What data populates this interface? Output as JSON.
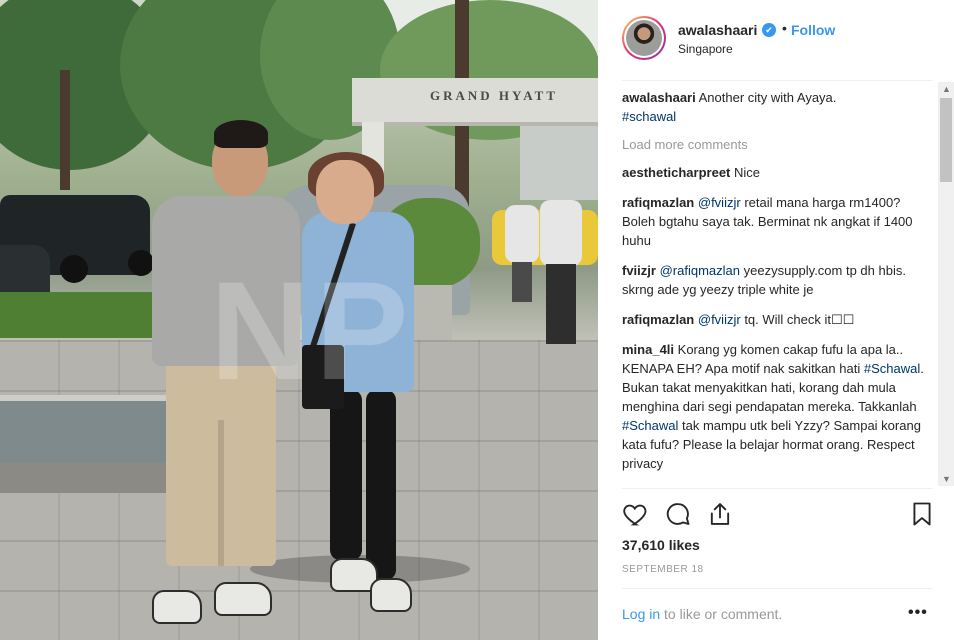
{
  "post": {
    "username": "awalashaari",
    "verified_icon": "✔",
    "separator": "•",
    "follow_label": "Follow",
    "location": "Singapore"
  },
  "photo": {
    "sign_text": "GRAND HYATT",
    "watermark": "NP"
  },
  "comments": {
    "caption_user": "awalashaari",
    "caption_text": "Another city with Ayaya.",
    "caption_tag": "#schawal",
    "load_more": "Load more comments",
    "items": [
      {
        "user": "aestheticharpreet",
        "text": "Nice"
      },
      {
        "user": "rafiqmazlan",
        "mention": "@fviizjr",
        "text": "retail mana harga rm1400? Boleh bgtahu saya tak. Berminat nk angkat if 1400 huhu"
      },
      {
        "user": "fviizjr",
        "mention": "@rafiqmazlan",
        "text": "yeezysupply.com tp dh hbis. skrng ade yg yeezy triple white je"
      },
      {
        "user": "rafiqmazlan",
        "mention": "@fviizjr",
        "text": "tq. Will check it☐☐"
      },
      {
        "user": "mina_4li",
        "text_a": "Korang yg komen cakap fufu la apa la.. KENAPA EH? Apa motif nak sakitkan hati",
        "tag_a": "#Schawal",
        "text_b": ". Bukan takat menyakitkan hati, korang dah mula menghina dari segi pendapatan mereka. Takkanlah",
        "tag_b": "#Schawal",
        "text_c": "tak mampu utk beli Yzzy? Sampai korang kata fufu? Please la belajar hormat orang. Respect privacy"
      }
    ]
  },
  "actions": {
    "like_icon": "heart-icon",
    "comment_icon": "comment-icon",
    "share_icon": "share-icon",
    "save_icon": "bookmark-icon"
  },
  "likes": "37,610 likes",
  "date": "SEPTEMBER 18",
  "footer": {
    "login_label": "Log in",
    "login_suffix": "to like or comment.",
    "more_label": "•••"
  },
  "colors": {
    "accent": "#3897f0",
    "text": "#262626",
    "muted": "#999999",
    "tag": "#003569"
  }
}
